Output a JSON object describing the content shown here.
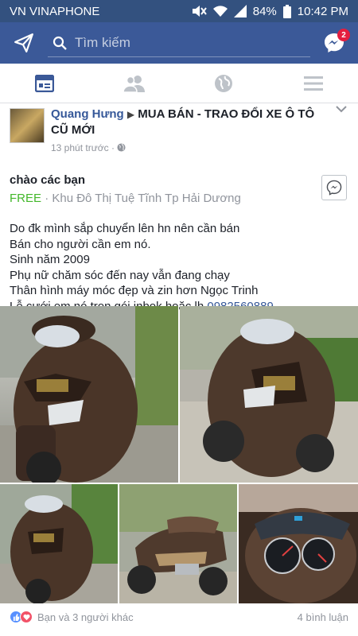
{
  "status": {
    "carrier": "VN VINAPHONE",
    "battery": "84%",
    "time": "10:42 PM"
  },
  "topbar": {
    "search_placeholder": "Tìm kiếm",
    "messenger_badge": "2"
  },
  "post": {
    "author": "Quang Hưng",
    "group": "MUA BÁN - TRAO ĐỔI XE Ô TÔ CŨ MỚI",
    "time": "13 phút trước",
    "sale_title": "chào các bạn",
    "price": "FREE",
    "location": "Khu Đô Thị Tuệ Tĩnh Tp Hải Dương",
    "lines": [
      "Do đk mình sắp chuyển lên hn nên cần bán",
      "Bán cho người cần em nó.",
      "Sinh năm 2009",
      "Phụ nữ chăm sóc đến nay vẫn đang chạy",
      "Thân hình máy móc đẹp và zin hơn Ngọc Trinh",
      "Lễ cưới em nó trọn gói inbok hoặc lh"
    ],
    "phone": "0982560889",
    "reactions_text": "Bạn và 3 người khác",
    "comments": "4 bình luận"
  },
  "colors": {
    "fb_blue": "#3b5998",
    "free_green": "#42b72a",
    "link": "#365899"
  }
}
